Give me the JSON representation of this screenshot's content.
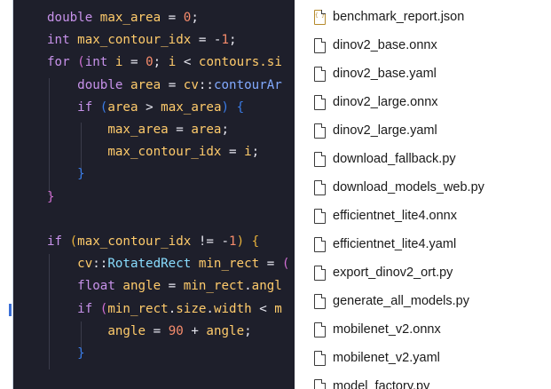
{
  "editor": {
    "lines": [
      [
        {
          "t": "double ",
          "c": "kw"
        },
        {
          "t": "max_area ",
          "c": "var"
        },
        {
          "t": "= ",
          "c": "punct"
        },
        {
          "t": "0",
          "c": "num"
        },
        {
          "t": ";",
          "c": "punct"
        }
      ],
      [
        {
          "t": "int ",
          "c": "kw"
        },
        {
          "t": "max_contour_idx ",
          "c": "var"
        },
        {
          "t": "= -",
          "c": "punct"
        },
        {
          "t": "1",
          "c": "num"
        },
        {
          "t": ";",
          "c": "punct"
        }
      ],
      [
        {
          "t": "for ",
          "c": "kw"
        },
        {
          "t": "(",
          "c": "brace-p"
        },
        {
          "t": "int ",
          "c": "kw"
        },
        {
          "t": "i ",
          "c": "var"
        },
        {
          "t": "= ",
          "c": "punct"
        },
        {
          "t": "0",
          "c": "num"
        },
        {
          "t": "; ",
          "c": "punct"
        },
        {
          "t": "i ",
          "c": "var"
        },
        {
          "t": "< ",
          "c": "punct"
        },
        {
          "t": "contours",
          "c": "var"
        },
        {
          "t": ".si",
          "c": "var"
        }
      ],
      [
        {
          "t": "    double ",
          "c": "kw"
        },
        {
          "t": "area ",
          "c": "var"
        },
        {
          "t": "= ",
          "c": "punct"
        },
        {
          "t": "cv",
          "c": "var"
        },
        {
          "t": "::",
          "c": "punct"
        },
        {
          "t": "contourAr",
          "c": "fn"
        }
      ],
      [
        {
          "t": "    if ",
          "c": "kw"
        },
        {
          "t": "(",
          "c": "brace"
        },
        {
          "t": "area ",
          "c": "var"
        },
        {
          "t": "> ",
          "c": "punct"
        },
        {
          "t": "max_area",
          "c": "var"
        },
        {
          "t": ") {",
          "c": "brace"
        }
      ],
      [
        {
          "t": "        max_area ",
          "c": "var"
        },
        {
          "t": "= ",
          "c": "punct"
        },
        {
          "t": "area",
          "c": "var"
        },
        {
          "t": ";",
          "c": "punct"
        }
      ],
      [
        {
          "t": "        max_contour_idx ",
          "c": "var"
        },
        {
          "t": "= ",
          "c": "punct"
        },
        {
          "t": "i",
          "c": "var"
        },
        {
          "t": ";",
          "c": "punct"
        }
      ],
      [
        {
          "t": "    }",
          "c": "brace"
        }
      ],
      [
        {
          "t": "}",
          "c": "brace-p"
        }
      ],
      [
        {
          "t": "",
          "c": "punct"
        }
      ],
      [
        {
          "t": "if ",
          "c": "kw"
        },
        {
          "t": "(",
          "c": "brace-y"
        },
        {
          "t": "max_contour_idx ",
          "c": "var"
        },
        {
          "t": "!= -",
          "c": "punct"
        },
        {
          "t": "1",
          "c": "num"
        },
        {
          "t": ") {",
          "c": "brace-y"
        }
      ],
      [
        {
          "t": "    cv",
          "c": "var"
        },
        {
          "t": "::",
          "c": "punct"
        },
        {
          "t": "RotatedRect ",
          "c": "ns"
        },
        {
          "t": "min_rect ",
          "c": "var"
        },
        {
          "t": "= ",
          "c": "punct"
        },
        {
          "t": "(",
          "c": "brace-p"
        }
      ],
      [
        {
          "t": "    float ",
          "c": "kw"
        },
        {
          "t": "angle ",
          "c": "var"
        },
        {
          "t": "= ",
          "c": "punct"
        },
        {
          "t": "min_rect",
          "c": "var"
        },
        {
          "t": ".",
          "c": "punct"
        },
        {
          "t": "angl",
          "c": "var"
        }
      ],
      [
        {
          "t": "    if ",
          "c": "kw"
        },
        {
          "t": "(",
          "c": "brace-p"
        },
        {
          "t": "min_rect",
          "c": "var"
        },
        {
          "t": ".",
          "c": "punct"
        },
        {
          "t": "size",
          "c": "var"
        },
        {
          "t": ".",
          "c": "punct"
        },
        {
          "t": "width ",
          "c": "var"
        },
        {
          "t": "< ",
          "c": "punct"
        },
        {
          "t": "m",
          "c": "var"
        }
      ],
      [
        {
          "t": "        angle ",
          "c": "var"
        },
        {
          "t": "= ",
          "c": "punct"
        },
        {
          "t": "90 ",
          "c": "num"
        },
        {
          "t": "+ ",
          "c": "punct"
        },
        {
          "t": "angle",
          "c": "var"
        },
        {
          "t": ";",
          "c": "punct"
        }
      ],
      [
        {
          "t": "    }",
          "c": "brace"
        }
      ]
    ]
  },
  "files": [
    {
      "name": "benchmark_report.json",
      "icon": "json-file-icon"
    },
    {
      "name": "dinov2_base.onnx",
      "icon": "file-icon"
    },
    {
      "name": "dinov2_base.yaml",
      "icon": "file-icon"
    },
    {
      "name": "dinov2_large.onnx",
      "icon": "file-icon"
    },
    {
      "name": "dinov2_large.yaml",
      "icon": "file-icon"
    },
    {
      "name": "download_fallback.py",
      "icon": "file-icon"
    },
    {
      "name": "download_models_web.py",
      "icon": "file-icon"
    },
    {
      "name": "efficientnet_lite4.onnx",
      "icon": "file-icon"
    },
    {
      "name": "efficientnet_lite4.yaml",
      "icon": "file-icon"
    },
    {
      "name": "export_dinov2_ort.py",
      "icon": "file-icon"
    },
    {
      "name": "generate_all_models.py",
      "icon": "file-icon"
    },
    {
      "name": "mobilenet_v2.onnx",
      "icon": "file-icon"
    },
    {
      "name": "mobilenet_v2.yaml",
      "icon": "file-icon"
    },
    {
      "name": "model_factory.py",
      "icon": "file-icon"
    }
  ],
  "colors": {
    "editor_bg": "#1e1f2b",
    "keyword": "#c792ea",
    "number": "#f78c6c",
    "function": "#82aaff",
    "variable": "#ffcb6b"
  }
}
